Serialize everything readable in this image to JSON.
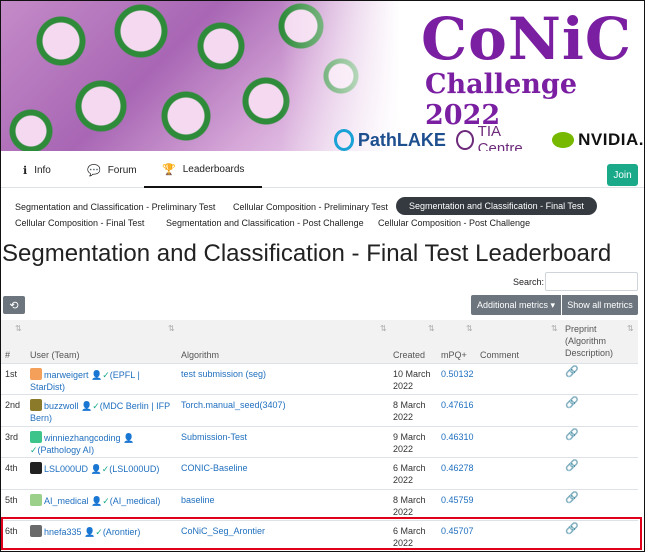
{
  "banner": {
    "title_main": "CoNiC",
    "title_sub": "Challenge 2022",
    "logos": {
      "pathlake": "PathLAKE",
      "tia": "TIA Centre",
      "nvidia": "NVIDIA."
    }
  },
  "nav": {
    "tabs": [
      {
        "label": "Info",
        "icon": "info-icon"
      },
      {
        "label": "Forum",
        "icon": "comments-icon"
      },
      {
        "label": "Leaderboards",
        "icon": "trophy-icon",
        "active": true
      }
    ],
    "join_label": "Join"
  },
  "subtabs": [
    {
      "label": "Segmentation and Classification - Preliminary Test"
    },
    {
      "label": "Cellular Composition - Preliminary Test"
    },
    {
      "label": "Segmentation and Classification - Final Test",
      "active": true
    },
    {
      "label": "Cellular Composition - Final Test"
    },
    {
      "label": "Segmentation and Classification - Post Challenge"
    },
    {
      "label": "Cellular Composition - Post Challenge"
    }
  ],
  "leaderboard_title": "Segmentation and Classification - Final Test Leaderboard",
  "search": {
    "label": "Search:",
    "value": ""
  },
  "buttons": {
    "history_icon": "history-icon",
    "additional_metrics": "Additional metrics ▾",
    "show_all_metrics": "Show all metrics"
  },
  "table": {
    "headers": {
      "rank": "#",
      "user": "User (Team)",
      "algorithm": "Algorithm",
      "created": "Created",
      "mpq": "mPQ+",
      "comment": "Comment",
      "preprint": "Preprint (Algorithm Description)"
    },
    "rows": [
      {
        "rank": "1st",
        "user": "marweigert",
        "team": "(EPFL | StarDist)",
        "algorithm": "test submission (seg)",
        "created": "10 March 2022",
        "mpq": "0.50132",
        "avatar_color": "#f5a05a"
      },
      {
        "rank": "2nd",
        "user": "buzzwoll",
        "team": "(MDC Berlin | IFP Bern)",
        "algorithm": "Torch.manual_seed(3407)",
        "created": "8 March 2022",
        "mpq": "0.47616",
        "avatar_color": "#8a7a2a"
      },
      {
        "rank": "3rd",
        "user": "winniezhangcoding",
        "team": "(Pathology AI)",
        "algorithm": "Submission-Test",
        "created": "9 March 2022",
        "mpq": "0.46310",
        "avatar_color": "#3cc48a"
      },
      {
        "rank": "4th",
        "user": "LSL000UD",
        "team": "(LSL000UD)",
        "algorithm": "CONIC-Baseline",
        "created": "6 March 2022",
        "mpq": "0.46278",
        "avatar_color": "#222222"
      },
      {
        "rank": "5th",
        "user": "AI_medical",
        "team": "(AI_medical)",
        "algorithm": "baseline",
        "created": "8 March 2022",
        "mpq": "0.45759",
        "avatar_color": "#9ad08a"
      },
      {
        "rank": "6th",
        "user": "hnefa335",
        "team": "(Arontier)",
        "algorithm": "CoNiC_Seg_Arontier",
        "created": "6 March 2022",
        "mpq": "0.45707",
        "avatar_color": "#6a6a6a",
        "highlighted": true
      }
    ]
  }
}
